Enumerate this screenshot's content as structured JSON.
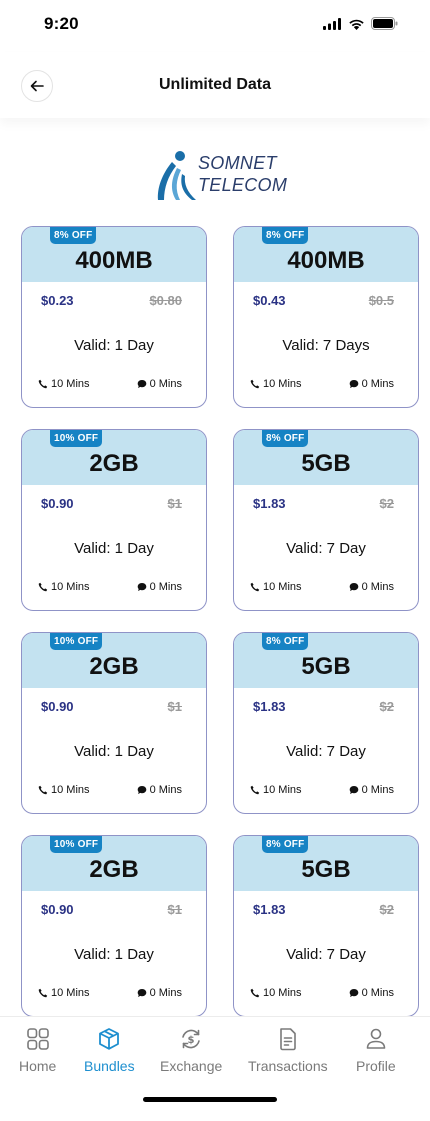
{
  "status_bar": {
    "time": "9:20"
  },
  "header": {
    "title": "Unlimited Data"
  },
  "logo": {
    "line1": "SOMNET",
    "line2": "TELECOM"
  },
  "bundles": [
    {
      "discount": "8% OFF",
      "size": "400MB",
      "price": "$0.23",
      "old_price": "$0.80",
      "validity": "Valid: 1 Day",
      "call_mins": "10 Mins",
      "sms_mins": "0 Mins"
    },
    {
      "discount": "8% OFF",
      "size": "400MB",
      "price": "$0.43",
      "old_price": "$0.5",
      "validity": "Valid: 7 Days",
      "call_mins": "10 Mins",
      "sms_mins": "0 Mins"
    },
    {
      "discount": "10% OFF",
      "size": "2GB",
      "price": "$0.90",
      "old_price": "$1",
      "validity": "Valid: 1 Day",
      "call_mins": "10 Mins",
      "sms_mins": "0 Mins"
    },
    {
      "discount": "8% OFF",
      "size": "5GB",
      "price": "$1.83",
      "old_price": "$2",
      "validity": "Valid: 7 Day",
      "call_mins": "10 Mins",
      "sms_mins": "0 Mins"
    },
    {
      "discount": "10% OFF",
      "size": "2GB",
      "price": "$0.90",
      "old_price": "$1",
      "validity": "Valid: 1 Day",
      "call_mins": "10 Mins",
      "sms_mins": "0 Mins"
    },
    {
      "discount": "8% OFF",
      "size": "5GB",
      "price": "$1.83",
      "old_price": "$2",
      "validity": "Valid: 7 Day",
      "call_mins": "10 Mins",
      "sms_mins": "0 Mins"
    },
    {
      "discount": "10% OFF",
      "size": "2GB",
      "price": "$0.90",
      "old_price": "$1",
      "validity": "Valid: 1 Day",
      "call_mins": "10 Mins",
      "sms_mins": "0 Mins"
    },
    {
      "discount": "8% OFF",
      "size": "5GB",
      "price": "$1.83",
      "old_price": "$2",
      "validity": "Valid: 7 Day",
      "call_mins": "10 Mins",
      "sms_mins": "0 Mins"
    }
  ],
  "nav": [
    {
      "label": "Home",
      "icon": "grid-icon",
      "active": false
    },
    {
      "label": "Bundles",
      "icon": "box-icon",
      "active": true
    },
    {
      "label": "Exchange",
      "icon": "exchange-icon",
      "active": false
    },
    {
      "label": "Transactions",
      "icon": "document-icon",
      "active": false
    },
    {
      "label": "Profile",
      "icon": "user-icon",
      "active": false
    }
  ],
  "colors": {
    "accent": "#1e8fcf",
    "card_header": "#c3e2f0",
    "badge": "#1683c4",
    "price": "#2a3284",
    "card_border": "#8f93c7"
  }
}
